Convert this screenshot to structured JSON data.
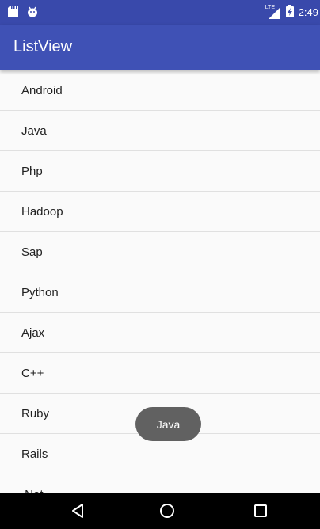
{
  "status_bar": {
    "time": "2:49",
    "left_icons": [
      "sd-card-icon",
      "android-debug-icon"
    ],
    "right_icons": [
      "lte-signal-icon",
      "battery-charging-icon"
    ],
    "signal_label": "LTE"
  },
  "app_bar": {
    "title": "ListView",
    "color": "#3f51b5",
    "status_color": "#3949ab"
  },
  "list": {
    "items": [
      "Android",
      "Java",
      "Php",
      "Hadoop",
      "Sap",
      "Python",
      "Ajax",
      "C++",
      "Ruby",
      "Rails",
      ".Net"
    ]
  },
  "toast": {
    "message": "Java"
  },
  "nav_bar": {
    "buttons": [
      "back-icon",
      "home-icon",
      "recents-icon"
    ]
  }
}
